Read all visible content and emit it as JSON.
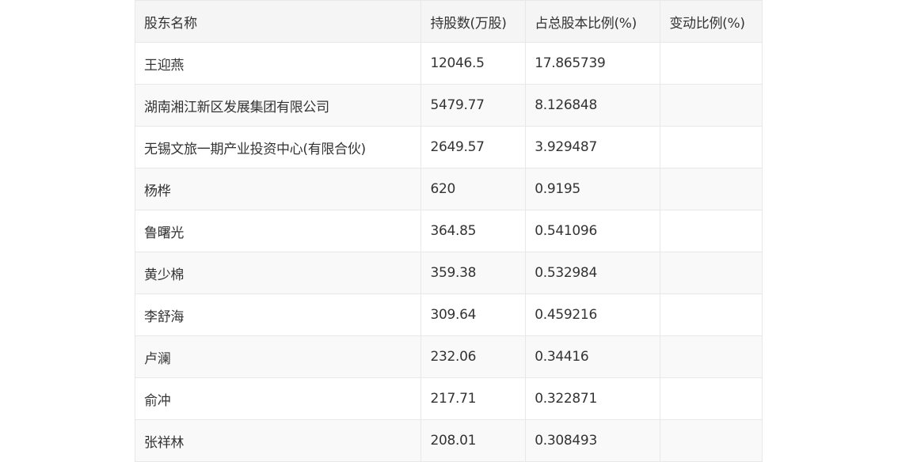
{
  "table": {
    "headers": {
      "name": "股东名称",
      "shares": "持股数(万股)",
      "ratio": "占总股本比例(%)",
      "change": "变动比例(%)"
    },
    "rows": [
      {
        "name": "王迎燕",
        "shares": "12046.5",
        "ratio": "17.865739",
        "change": ""
      },
      {
        "name": "湖南湘江新区发展集团有限公司",
        "shares": "5479.77",
        "ratio": "8.126848",
        "change": ""
      },
      {
        "name": "无锡文旅一期产业投资中心(有限合伙)",
        "shares": "2649.57",
        "ratio": "3.929487",
        "change": ""
      },
      {
        "name": "杨桦",
        "shares": "620",
        "ratio": "0.9195",
        "change": ""
      },
      {
        "name": "鲁曙光",
        "shares": "364.85",
        "ratio": "0.541096",
        "change": ""
      },
      {
        "name": "黄少棉",
        "shares": "359.38",
        "ratio": "0.532984",
        "change": ""
      },
      {
        "name": "李舒海",
        "shares": "309.64",
        "ratio": "0.459216",
        "change": ""
      },
      {
        "name": "卢澜",
        "shares": "232.06",
        "ratio": "0.34416",
        "change": ""
      },
      {
        "name": "俞冲",
        "shares": "217.71",
        "ratio": "0.322871",
        "change": ""
      },
      {
        "name": "张祥林",
        "shares": "208.01",
        "ratio": "0.308493",
        "change": ""
      }
    ]
  }
}
